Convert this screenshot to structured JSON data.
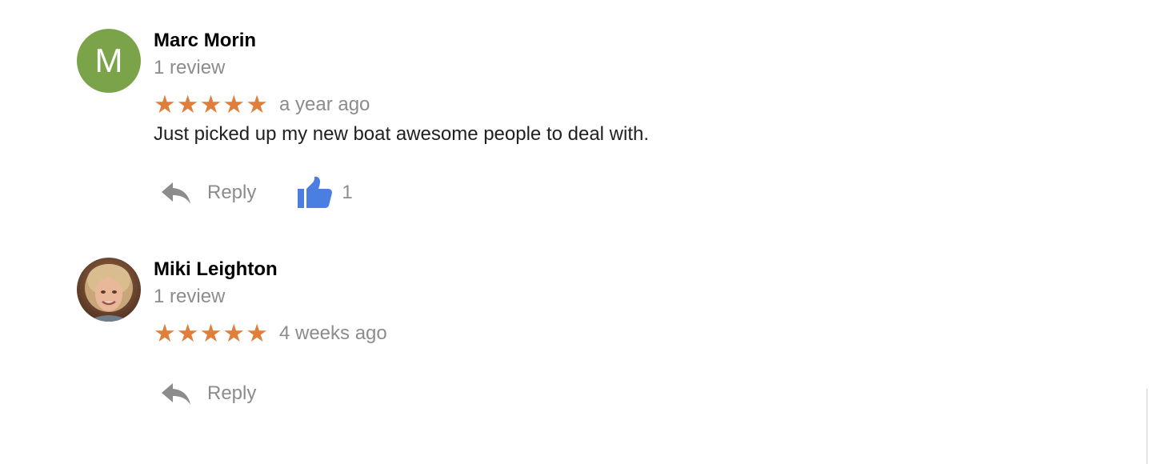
{
  "colors": {
    "star": "#e07f3c",
    "secondary_text": "#8c8c8c",
    "like_blue": "#4a7fe1",
    "avatar_green": "#7ba44a"
  },
  "reviews": [
    {
      "avatar": {
        "type": "letter",
        "letter": "M",
        "color": "#7ba44a"
      },
      "name": "Marc Morin",
      "review_count": "1 review",
      "rating": 5,
      "stars": "★★★★★",
      "time": "a year ago",
      "text": "Just picked up my new boat awesome people to deal with.",
      "reply_label": "Reply",
      "like_count": "1"
    },
    {
      "avatar": {
        "type": "photo",
        "icon": "profile-photo"
      },
      "name": "Miki Leighton",
      "review_count": "1 review",
      "rating": 5,
      "stars": "★★★★★",
      "time": "4 weeks ago",
      "text": "",
      "reply_label": "Reply"
    }
  ]
}
